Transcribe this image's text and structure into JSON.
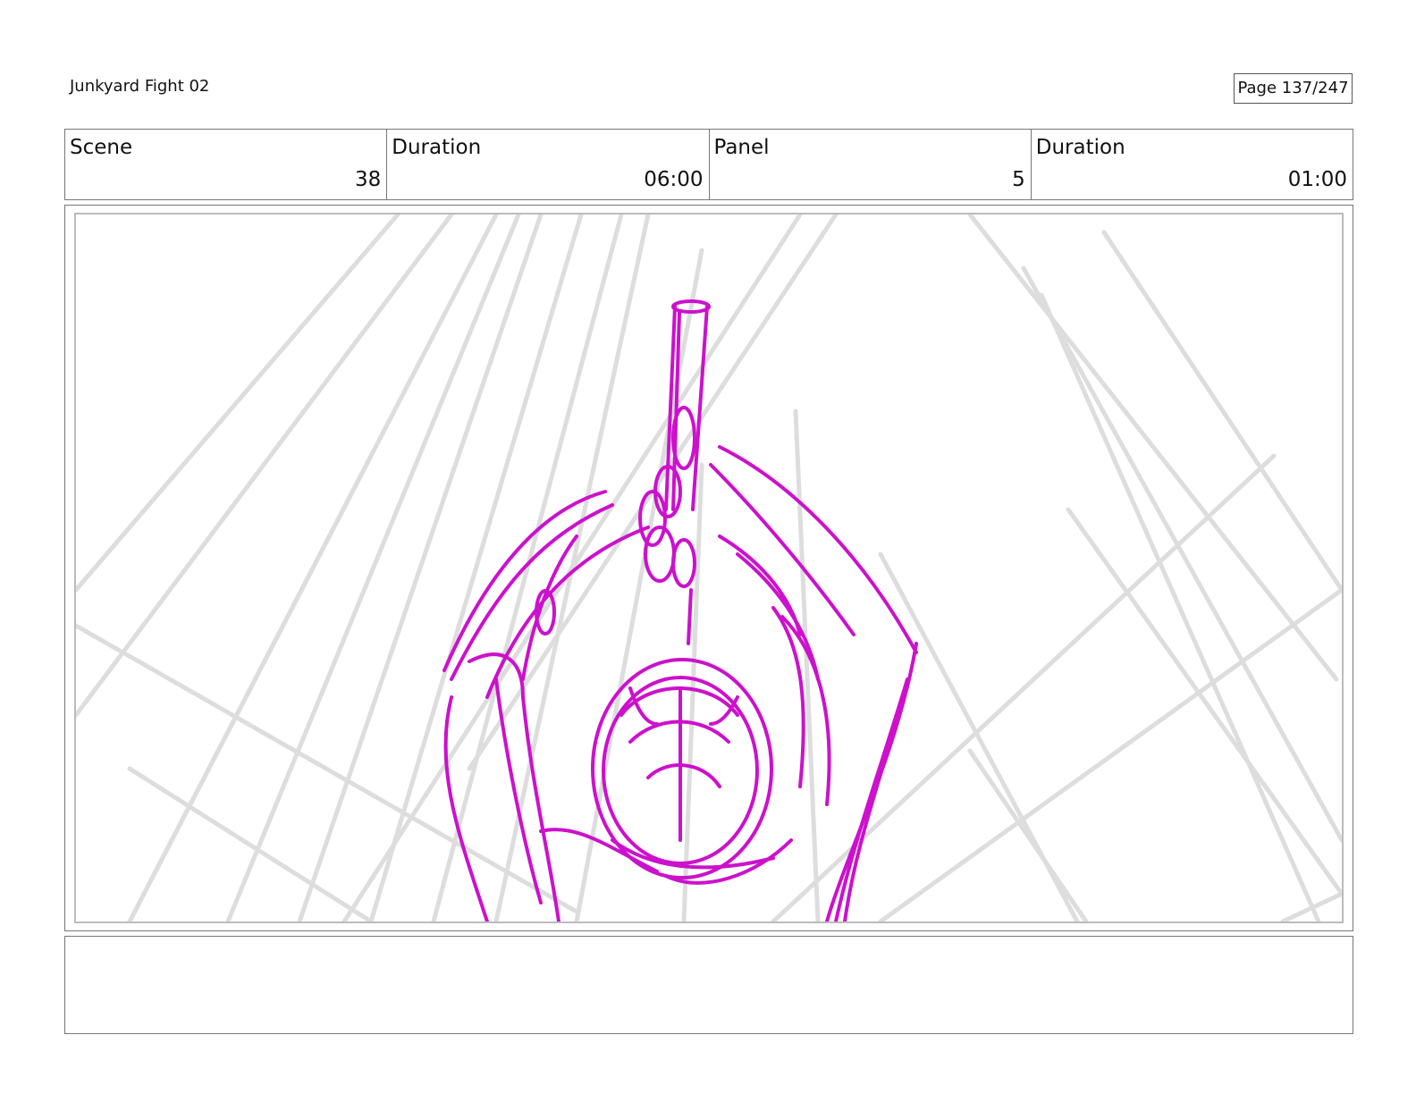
{
  "header": {
    "project_title": "Junkyard Fight 02",
    "page_label": "Page 137/247"
  },
  "info_bar": {
    "scene_label": "Scene",
    "scene_value": "38",
    "scene_duration_label": "Duration",
    "scene_duration_value": "06:00",
    "panel_label": "Panel",
    "panel_value": "5",
    "panel_duration_label": "Duration",
    "panel_duration_value": "01:00"
  },
  "panel": {
    "sketch_subject": "sketch-of-figure-with-pipe",
    "colors": {
      "sketch_stroke": "#cc11cc",
      "background_lines": "#dddddd"
    }
  },
  "notes": {
    "text": ""
  }
}
